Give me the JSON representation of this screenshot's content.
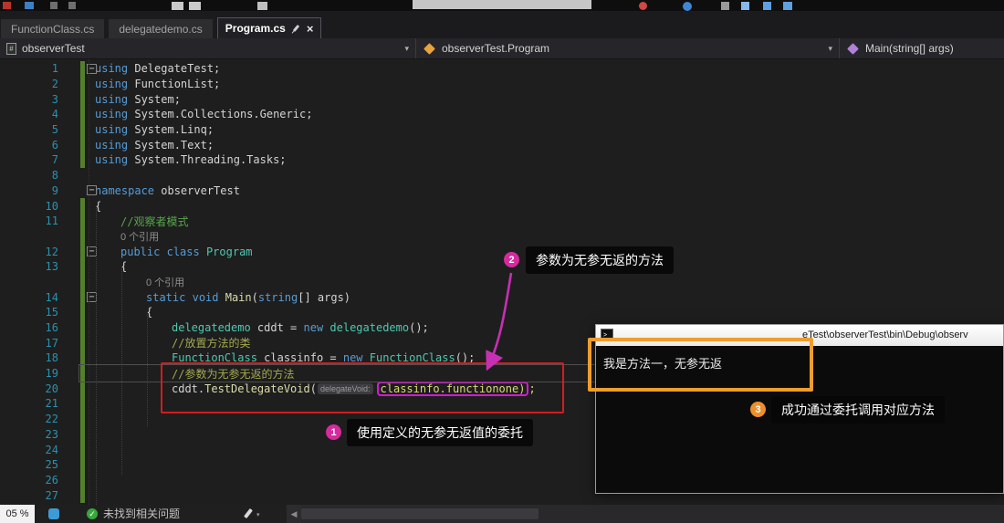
{
  "tabs": {
    "items": [
      {
        "label": "FunctionClass.cs"
      },
      {
        "label": "delegatedemo.cs"
      },
      {
        "label": "Program.cs"
      }
    ],
    "active": "Program.cs"
  },
  "breadcrumb": {
    "project": "observerTest",
    "type": "observerTest.Program",
    "member": "Main(string[] args)"
  },
  "code": {
    "codelens_label": "0 个引用",
    "rows": [
      {
        "n": 1,
        "f": 1,
        "g": 1,
        "i": 0,
        "t": [
          [
            "k",
            "using"
          ],
          [
            "p",
            " DelegateTest;"
          ]
        ]
      },
      {
        "n": 2,
        "g": 1,
        "i": 0,
        "t": [
          [
            "k",
            "using"
          ],
          [
            "p",
            " FunctionList;"
          ]
        ]
      },
      {
        "n": 3,
        "g": 1,
        "i": 0,
        "t": [
          [
            "k",
            "using"
          ],
          [
            "p",
            " System;"
          ]
        ]
      },
      {
        "n": 4,
        "g": 1,
        "i": 0,
        "t": [
          [
            "k",
            "using"
          ],
          [
            "p",
            " System.Collections.Generic;"
          ]
        ]
      },
      {
        "n": 5,
        "g": 1,
        "i": 0,
        "t": [
          [
            "k",
            "using"
          ],
          [
            "p",
            " System.Linq;"
          ]
        ]
      },
      {
        "n": 6,
        "g": 1,
        "i": 0,
        "t": [
          [
            "k",
            "using"
          ],
          [
            "p",
            " System.Text;"
          ]
        ]
      },
      {
        "n": 7,
        "g": 1,
        "i": 0,
        "t": [
          [
            "k",
            "using"
          ],
          [
            "p",
            " System.Threading.Tasks;"
          ]
        ]
      },
      {
        "n": 8,
        "i": 0,
        "t": []
      },
      {
        "n": 9,
        "f": 1,
        "i": 0,
        "t": [
          [
            "k",
            "namespace"
          ],
          [
            "p",
            " observerTest"
          ]
        ]
      },
      {
        "n": 10,
        "g": 1,
        "i": 0,
        "t": [
          [
            "p",
            "{"
          ]
        ]
      },
      {
        "n": 11,
        "g": 1,
        "i": 1,
        "t": [
          [
            "c",
            "//观察者模式"
          ]
        ]
      },
      {
        "lens": 1,
        "g": 1,
        "i": 1
      },
      {
        "n": 12,
        "f": 1,
        "g": 1,
        "i": 1,
        "t": [
          [
            "k",
            "public"
          ],
          [
            "p",
            " "
          ],
          [
            "k",
            "class"
          ],
          [
            "ty",
            " Program"
          ]
        ]
      },
      {
        "n": 13,
        "g": 1,
        "i": 1,
        "t": [
          [
            "p",
            "{"
          ]
        ]
      },
      {
        "lens": 1,
        "g": 1,
        "i": 2
      },
      {
        "n": 14,
        "f": 1,
        "g": 1,
        "i": 2,
        "t": [
          [
            "k",
            "static"
          ],
          [
            "p",
            " "
          ],
          [
            "k",
            "void"
          ],
          [
            "m",
            " Main"
          ],
          [
            "p",
            "("
          ],
          [
            "k",
            "string"
          ],
          [
            "p",
            "[] args)"
          ]
        ]
      },
      {
        "n": 15,
        "g": 1,
        "i": 2,
        "t": [
          [
            "p",
            "{"
          ]
        ]
      },
      {
        "n": 16,
        "g": 1,
        "i": 3,
        "t": [
          [
            "ty",
            "delegatedemo"
          ],
          [
            "p",
            " cddt = "
          ],
          [
            "k",
            "new"
          ],
          [
            "ty",
            " delegatedemo"
          ],
          [
            "p",
            "();"
          ]
        ]
      },
      {
        "n": 17,
        "g": 1,
        "i": 3,
        "t": [
          [
            "c2",
            "//放置方法的类"
          ]
        ]
      },
      {
        "n": 18,
        "g": 1,
        "i": 3,
        "t": [
          [
            "ty",
            "FunctionClass"
          ],
          [
            "p",
            " classinfo = "
          ],
          [
            "k",
            "new"
          ],
          [
            "ty",
            " FunctionClass"
          ],
          [
            "p",
            "();"
          ]
        ]
      },
      {
        "n": 19,
        "g": 1,
        "i": 3,
        "t": [
          [
            "c2",
            "//参数为无参无返的方法"
          ]
        ]
      },
      {
        "n": 20,
        "g": 1,
        "i": 3,
        "t": [
          [
            "p",
            "cddt."
          ],
          [
            "m",
            "TestDelegateVoid"
          ],
          [
            "p",
            "("
          ],
          [
            "hint",
            "delegateVoid:"
          ],
          [
            "box",
            "classinfo.functionone)"
          ],
          [
            "p2",
            ";"
          ]
        ]
      },
      {
        "n": 21,
        "g": 1,
        "i": 3,
        "t": []
      },
      {
        "n": 22,
        "g": 1,
        "i": 2,
        "t": []
      },
      {
        "n": 23,
        "g": 1,
        "i": 2,
        "t": []
      },
      {
        "n": 24,
        "g": 1,
        "i": 1,
        "t": []
      },
      {
        "n": 25,
        "g": 1,
        "i": 1,
        "t": []
      },
      {
        "n": 26,
        "g": 1,
        "i": 0,
        "t": []
      },
      {
        "n": 27,
        "g": 1,
        "i": 0,
        "t": []
      }
    ]
  },
  "annotations": {
    "step1": {
      "num": "1",
      "label": "使用定义的无参无返值的委托"
    },
    "step2": {
      "num": "2",
      "label": "参数为无参无返的方法"
    },
    "step3": {
      "num": "3",
      "label": "成功通过委托调用对应方法"
    },
    "colors": {
      "magenta_badge": "#d62a9d",
      "orange_badge": "#ed8f2a",
      "red_rect": "#cf1f1f",
      "magenta_box": "#d619d6",
      "orange_rect": "#ee9d2e",
      "arrow": "#c72fb4"
    }
  },
  "console": {
    "title_path": "eTest\\observerTest\\bin\\Debug\\observ",
    "output": "我是方法一，无参无返"
  },
  "statusbar": {
    "zoom": "05 %",
    "issues": "未找到相关问题"
  },
  "icons": {
    "close": "×",
    "chevron": "▾",
    "check": "✓",
    "fold": "−",
    "scroll_left": "◀",
    "hash": "#",
    "prompt": ">_"
  }
}
